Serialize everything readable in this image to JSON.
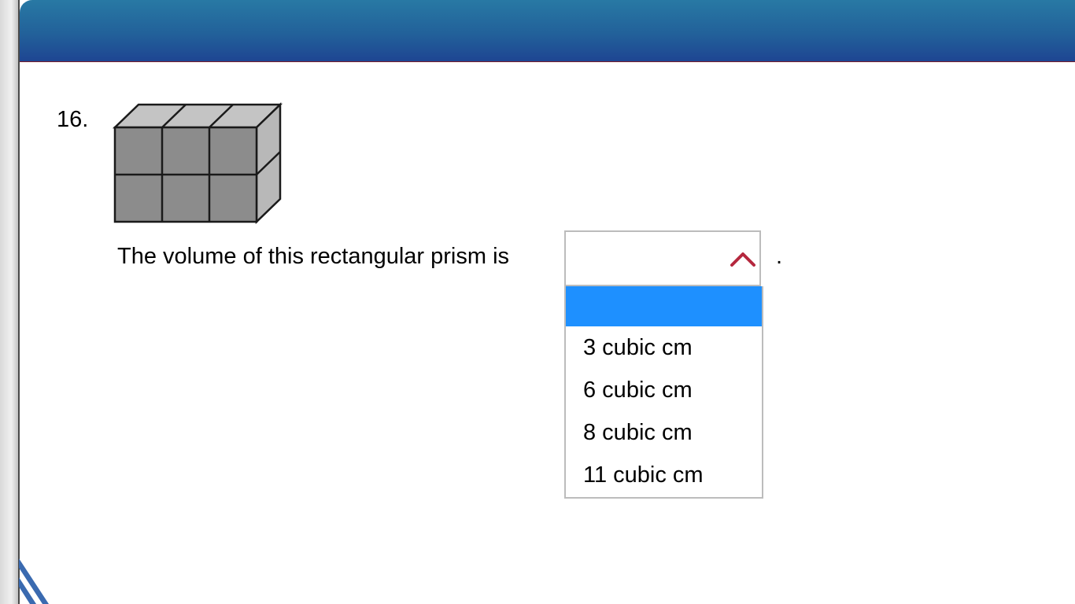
{
  "question": {
    "number": "16.",
    "text": "The volume of this rectangular prism is",
    "trailing_punctuation": "."
  },
  "answer_select": {
    "selected_value": "",
    "expanded": true,
    "options": [
      "",
      "3 cubic cm",
      "6 cubic cm",
      "8 cubic cm",
      "11 cubic cm"
    ],
    "highlighted_index": 0
  },
  "figure": {
    "icon": "rectangular-prism-cubes-image",
    "cube_columns": 3,
    "cube_rows": 2,
    "cube_depth": 1
  },
  "colors": {
    "header_top": "#2879a4",
    "header_bottom": "#1e4592",
    "highlight": "#1e90ff",
    "arrow": "#b5283e",
    "cube_front": "#8c8c8c",
    "cube_top": "#c4c4c4"
  }
}
